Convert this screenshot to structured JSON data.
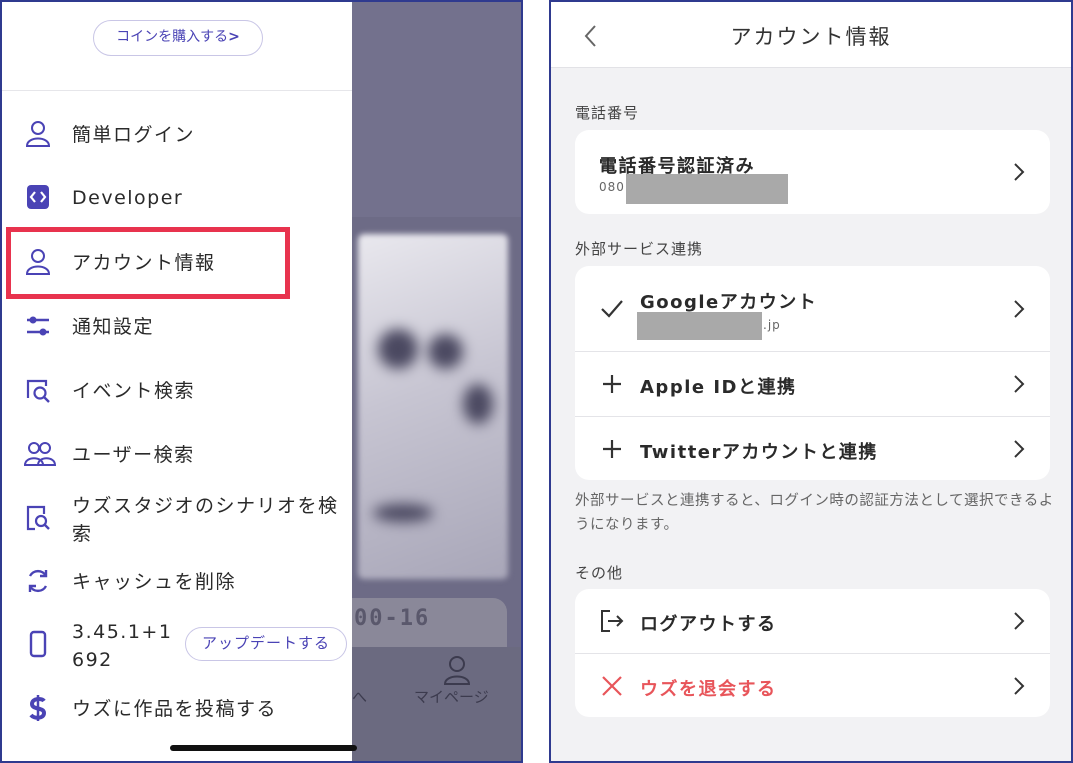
{
  "left": {
    "coin_button": "コインを購入する",
    "menu": [
      {
        "label": "簡単ログイン",
        "icon": "person-icon"
      },
      {
        "label": "Developer",
        "icon": "code-icon"
      },
      {
        "label": "アカウント情報",
        "icon": "person-icon"
      },
      {
        "label": "通知設定",
        "icon": "sliders-icon"
      },
      {
        "label": "イベント検索",
        "icon": "event-search-icon"
      },
      {
        "label": "ユーザー検索",
        "icon": "users-icon"
      },
      {
        "label": "ウズスタジオのシナリオを検索",
        "icon": "document-search-icon"
      },
      {
        "label": "キャッシュを削除",
        "icon": "refresh-icon"
      },
      {
        "label": "3.45.1+1692",
        "icon": "phone-icon"
      },
      {
        "label": "ウズに作品を投稿する",
        "icon": "dollar-icon"
      }
    ],
    "update_button": "アップデートする",
    "background": {
      "tab_label": "マイページ",
      "ribbon_text": "00-16"
    },
    "colors": {
      "accent": "#4a43b5",
      "highlight": "#e8334e"
    }
  },
  "right": {
    "title": "アカウント情報",
    "phone_section": {
      "label": "電話番号",
      "title": "電話番号認証済み",
      "number_prefix": "080"
    },
    "external_section": {
      "label": "外部サービス連携",
      "google": {
        "title": "Googleアカウント",
        "email_suffix": ".jp"
      },
      "apple": {
        "title": "Apple IDと連携"
      },
      "twitter": {
        "title": "Twitterアカウントと連携"
      }
    },
    "note": "外部サービスと連携すると、ログイン時の認証方法として選択できるようになります。",
    "other_section": {
      "label": "その他",
      "logout": "ログアウトする",
      "withdraw": "ウズを退会する"
    },
    "colors": {
      "danger": "#e8555a"
    }
  }
}
